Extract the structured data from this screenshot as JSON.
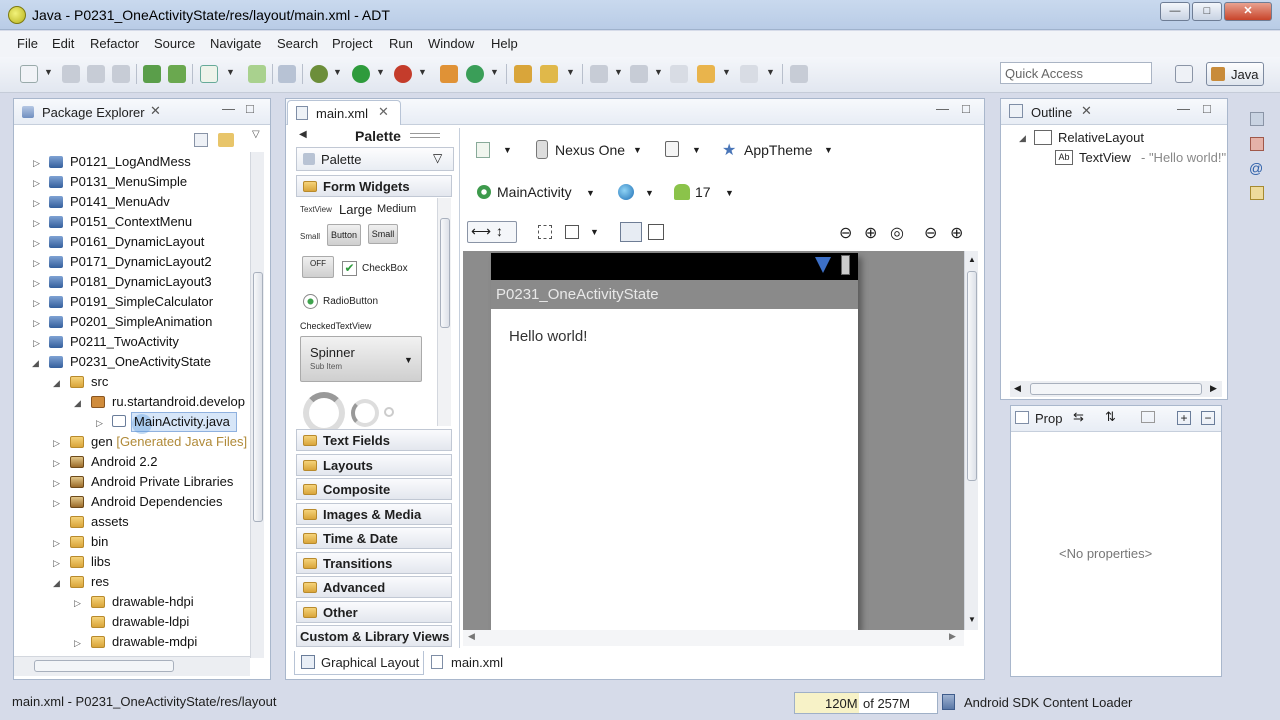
{
  "window": {
    "title": "Java - P0231_OneActivityState/res/layout/main.xml - ADT",
    "min": "—",
    "max": "□",
    "close": "✕"
  },
  "menu": [
    "File",
    "Edit",
    "Refactor",
    "Source",
    "Navigate",
    "Search",
    "Project",
    "Run",
    "Window",
    "Help"
  ],
  "toolbar": {
    "quick_access": "Quick Access",
    "perspective": "Java"
  },
  "package_explorer": {
    "title": "Package Explorer",
    "items": [
      {
        "label": "P0121_LogAndMess"
      },
      {
        "label": "P0131_MenuSimple"
      },
      {
        "label": "P0141_MenuAdv"
      },
      {
        "label": "P0151_ContextMenu"
      },
      {
        "label": "P0161_DynamicLayout"
      },
      {
        "label": "P0171_DynamicLayout2"
      },
      {
        "label": "P0181_DynamicLayout3"
      },
      {
        "label": "P0191_SimpleCalculator"
      },
      {
        "label": "P0201_SimpleAnimation"
      },
      {
        "label": "P0211_TwoActivity"
      },
      {
        "label": "P0231_OneActivityState"
      },
      {
        "label": "src"
      },
      {
        "label": "ru.startandroid.develop"
      },
      {
        "label": "MainActivity.java"
      },
      {
        "label": "gen",
        "suffix": "[Generated Java Files]"
      },
      {
        "label": "Android 2.2"
      },
      {
        "label": "Android Private Libraries"
      },
      {
        "label": "Android Dependencies"
      },
      {
        "label": "assets"
      },
      {
        "label": "bin"
      },
      {
        "label": "libs"
      },
      {
        "label": "res"
      },
      {
        "label": "drawable-hdpi"
      },
      {
        "label": "drawable-ldpi"
      },
      {
        "label": "drawable-mdpi"
      }
    ]
  },
  "editor": {
    "tab": "main.xml",
    "palette_header": "Palette",
    "palette_dropdown": "Palette",
    "form_widgets": "Form Widgets",
    "widgets": {
      "textview": "TextView",
      "large": "Large",
      "medium": "Medium",
      "small": "Small",
      "button": "Button",
      "small_btn": "Small",
      "off": "OFF",
      "checkbox": "CheckBox",
      "radiobutton": "RadioButton",
      "checkedtextview": "CheckedTextView",
      "spinner": "Spinner",
      "spinner_sub": "Sub Item"
    },
    "categories": [
      "Text Fields",
      "Layouts",
      "Composite",
      "Images & Media",
      "Time & Date",
      "Transitions",
      "Advanced",
      "Other"
    ],
    "custom": "Custom & Library Views",
    "device": "Nexus One",
    "theme": "AppTheme",
    "activity": "MainActivity",
    "api": "17",
    "preview": {
      "app_title": "P0231_OneActivityState",
      "text": "Hello world!"
    },
    "bottom_tabs": [
      "Graphical Layout",
      "main.xml"
    ]
  },
  "outline": {
    "title": "Outline",
    "root": "RelativeLayout",
    "child": "TextView",
    "child_value": "- \"Hello world!\""
  },
  "properties": {
    "title": "Prop",
    "empty": "<No properties>"
  },
  "status": {
    "path": "main.xml - P0231_OneActivityState/res/layout",
    "memory_used": "120M",
    "memory_total": "of 257M",
    "loader": "Android SDK Content Loader"
  }
}
